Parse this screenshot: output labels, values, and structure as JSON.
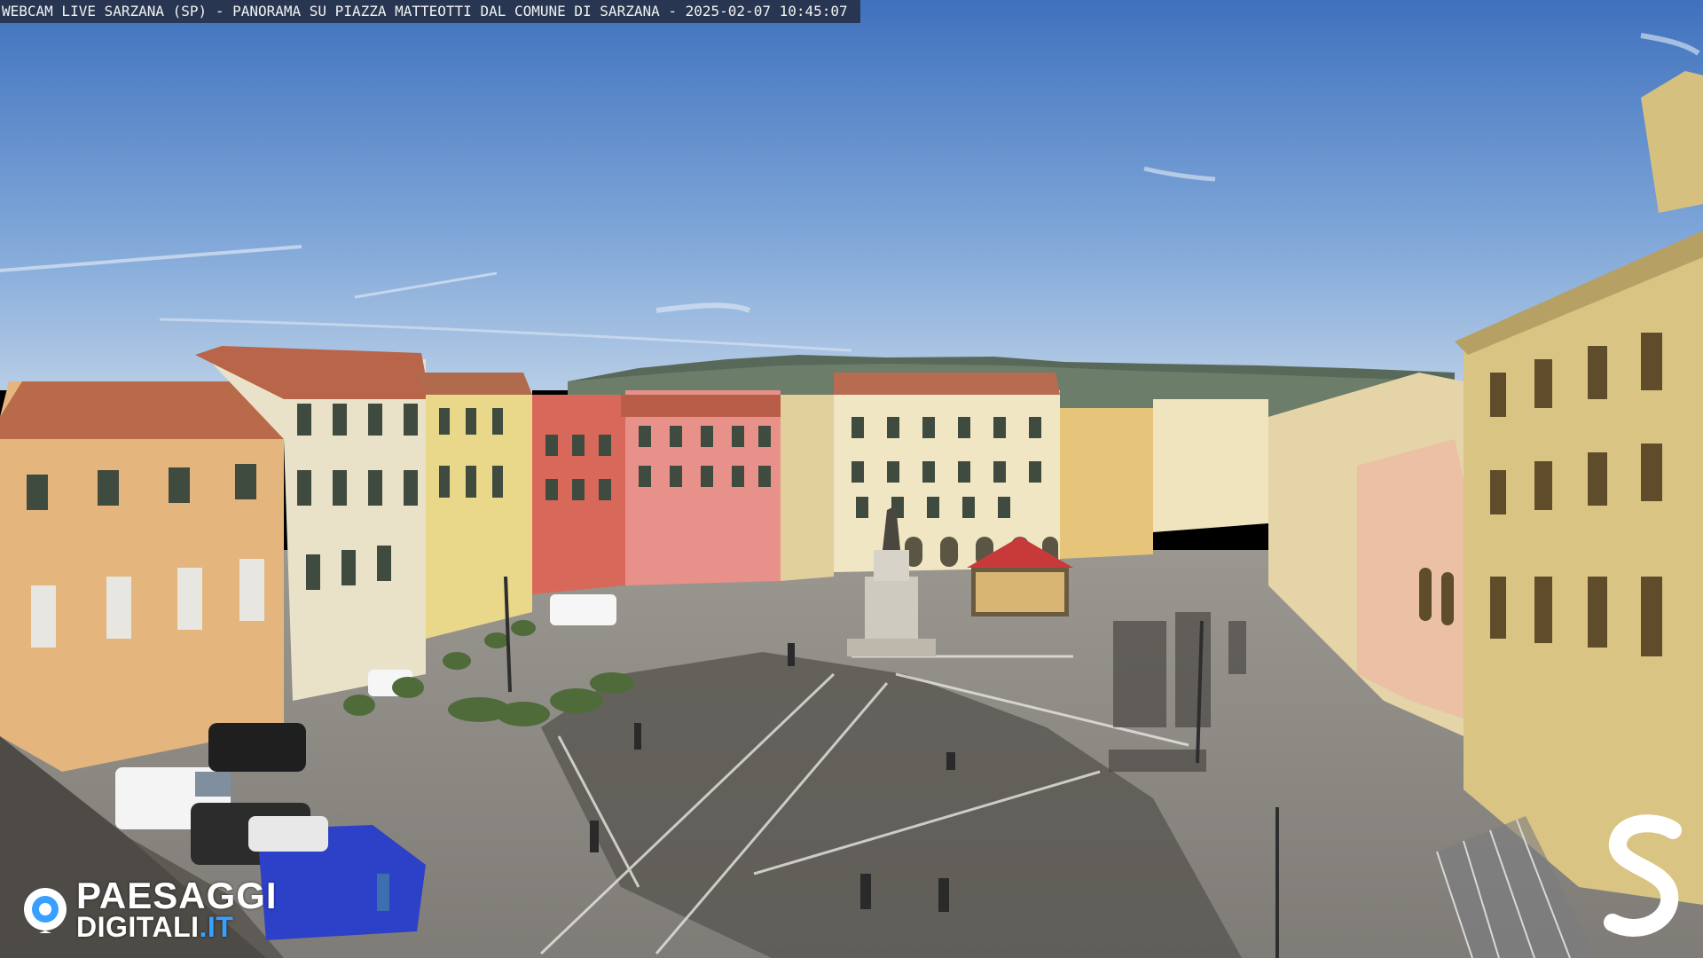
{
  "overlay": {
    "title": "WEBCAM LIVE SARZANA (SP) - PANORAMA SU PIAZZA MATTEOTTI DAL COMUNE DI SARZANA - 2025-02-07  10:45:07"
  },
  "watermark": {
    "brand_line1": "PAESAGGI",
    "brand_line2_main": "DIGITALI",
    "brand_line2_suffix": ".IT",
    "brand_icon": "eye-icon",
    "corner_mark": "s-logo-icon"
  },
  "colors": {
    "sky_top": "#4a7cc4",
    "sky_bottom": "#a9c4e4",
    "pavement": "#8c8a86",
    "shadow": "#55524d",
    "brand_blue": "#3aa0ff"
  }
}
